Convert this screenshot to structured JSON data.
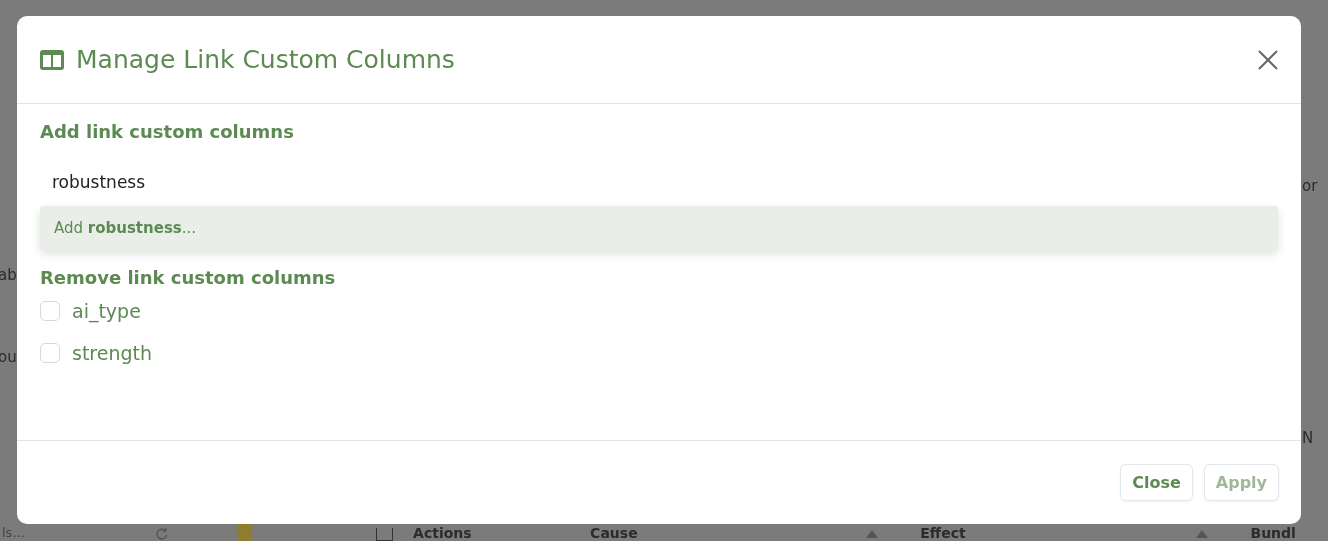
{
  "background": {
    "left_fragments": [
      "ab",
      "ou"
    ],
    "right_fragments": [
      "or",
      "N"
    ],
    "bottom_bar": {
      "search_fragment": "ls...",
      "select_all": {
        "checked": false
      },
      "columns": [
        "Actions",
        "Cause",
        "Effect",
        "Bundl"
      ]
    }
  },
  "dialog": {
    "title": "Manage Link Custom Columns",
    "add_section": {
      "heading": "Add link custom columns",
      "input": {
        "value": "robustness"
      },
      "suggestion": "Add **robustness**..."
    },
    "remove_section": {
      "heading": "Remove link custom columns",
      "items": [
        {
          "label": "ai_type",
          "checked": false
        },
        {
          "label": "strength",
          "checked": false
        }
      ]
    },
    "buttons": [
      {
        "label": "Close",
        "disabled": false
      },
      {
        "label": "Apply",
        "disabled": true
      }
    ]
  }
}
